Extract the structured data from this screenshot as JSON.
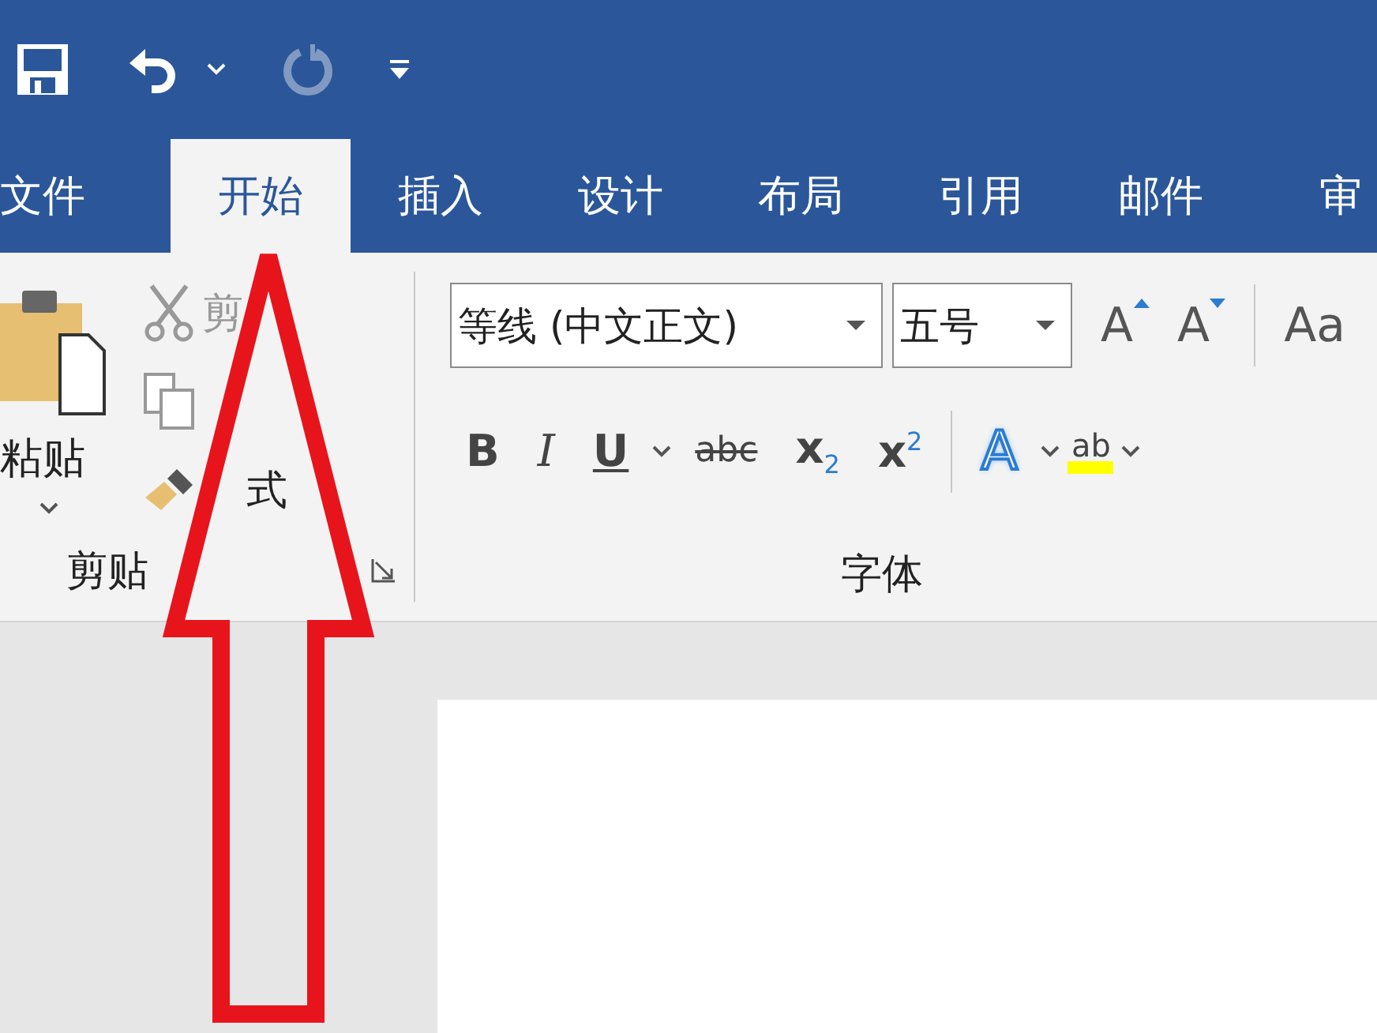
{
  "quick_access": {
    "redo": {
      "disabled": true
    }
  },
  "tabs": [
    {
      "label": "文件",
      "selected": false
    },
    {
      "label": "开始",
      "selected": true
    },
    {
      "label": "插入",
      "selected": false
    },
    {
      "label": "设计",
      "selected": false
    },
    {
      "label": "布局",
      "selected": false
    },
    {
      "label": "引用",
      "selected": false
    },
    {
      "label": "邮件",
      "selected": false
    },
    {
      "label": "审",
      "selected": false
    }
  ],
  "clipboard": {
    "paste_label": "粘贴",
    "cut_label": "剪",
    "format_painter_label": "式",
    "group_label": "剪贴"
  },
  "font": {
    "font_name": "等线 (中文正文)",
    "font_size": "五号",
    "group_label": "字体",
    "format_buttons": [
      {
        "kind": "bold",
        "label": "B"
      },
      {
        "kind": "italic",
        "label": "I"
      },
      {
        "kind": "underline",
        "label": "U"
      },
      {
        "kind": "strike",
        "label": "abc"
      },
      {
        "kind": "script",
        "label": "x$_{2}$"
      },
      {
        "kind": "script",
        "label": "x$^{2}$"
      },
      {
        "kind": "effect",
        "label": "A"
      },
      {
        "kind": "highlight",
        "label": "ab"
      }
    ],
    "case_label": "Aa",
    "grow_label": "A",
    "shrink_label": "A"
  }
}
